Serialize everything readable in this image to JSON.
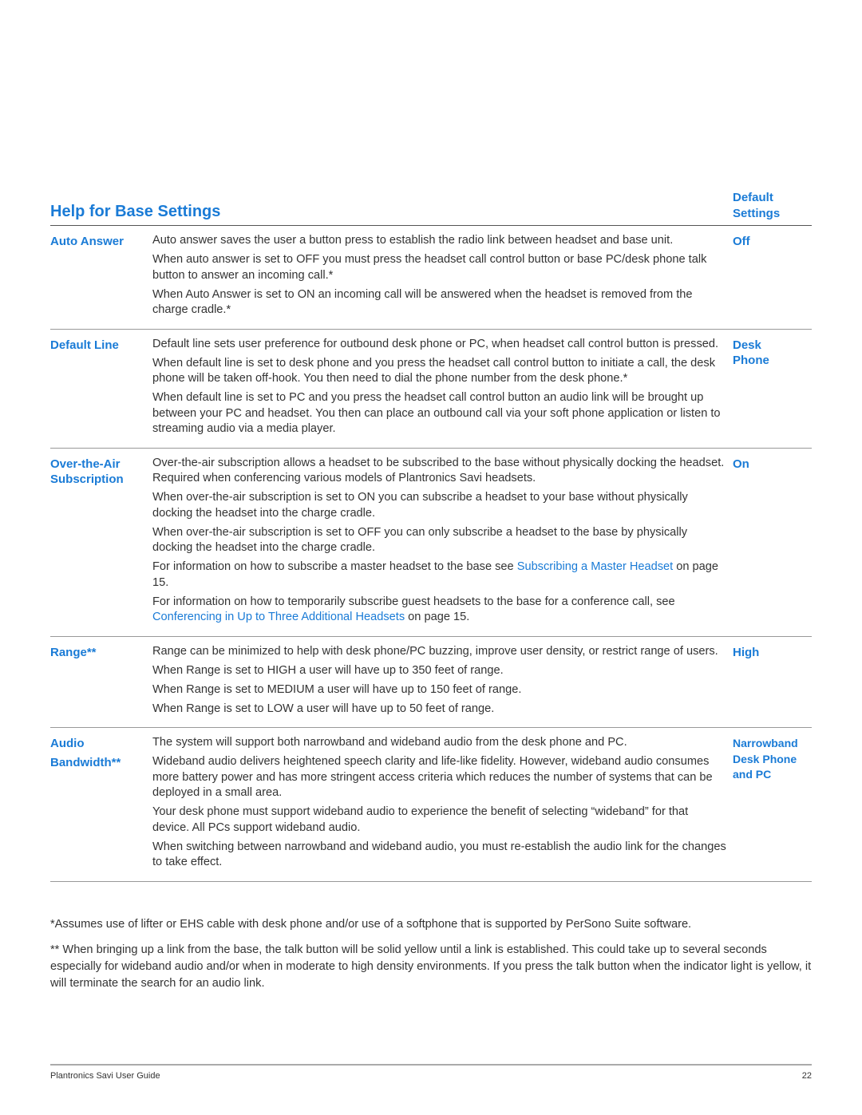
{
  "header": {
    "title": "Help for Base Settings",
    "default_column_line1": "Default",
    "default_column_line2": "Settings"
  },
  "rows": [
    {
      "label_line1": "Auto Answer",
      "label_line2": "",
      "default_lines": [
        "Off"
      ],
      "paragraphs": [
        "Auto answer saves the user a button press to establish the radio link between headset and base unit.",
        "When auto answer is set to OFF you must press the headset call control button or base PC/desk phone talk button to answer an incoming call.*",
        "When Auto Answer is set to ON an incoming call will be answered when the headset is removed from the charge cradle.*"
      ]
    },
    {
      "label_line1": "Default Line",
      "label_line2": "",
      "default_lines": [
        "Desk",
        "Phone"
      ],
      "paragraphs": [
        "Default line sets user preference for outbound desk phone or PC, when headset call control button is pressed.",
        "When default line is set to desk phone and you press the headset call control button to initiate a call, the desk phone will be taken off-hook. You then need to dial the phone number from the desk phone.*",
        "When default line is set to PC and you press the headset call control button an audio link will be brought up between your PC and headset. You then can place an outbound call via your soft phone application or listen to streaming audio via a media player."
      ]
    },
    {
      "label_line1": "Over-the-Air",
      "label_line2": "Subscription",
      "default_lines": [
        "On"
      ],
      "paragraphs": [
        "Over-the-air subscription allows a headset to be subscribed to the base without physically docking the headset. Required when conferencing various models of Plantronics Savi headsets.",
        "When over-the-air subscription is set to ON you can subscribe a headset to your base without physically docking the headset into the charge cradle.",
        "When over-the-air subscription is set to OFF you can only subscribe a headset to the base by physically docking the headset into the charge cradle."
      ],
      "link_paragraphs": [
        {
          "before": "For information on how to subscribe a master headset to the base see ",
          "link": "Subscribing a Master Headset",
          "after": " on page 15."
        },
        {
          "before": "For information on how to temporarily subscribe guest headsets to the base for a conference call, see ",
          "link": "Conferencing in Up to Three Additional Headsets",
          "after": " on page 15."
        }
      ]
    },
    {
      "label_line1": "Range**",
      "label_line2": "",
      "default_lines": [
        "High"
      ],
      "paragraphs": [
        "Range can be minimized to help with desk phone/PC buzzing, improve user density, or restrict range of users.",
        "When Range is set to HIGH a user will have up to 350 feet of range.",
        "When Range is set to MEDIUM a user will have up to 150 feet of range.",
        "When Range is set to LOW a user will have up to 50 feet of range."
      ]
    },
    {
      "label_line1": "Audio",
      "label_line2": "Bandwidth**",
      "default_lines": [
        "Narrowband",
        "Desk Phone",
        "and PC"
      ],
      "paragraphs": [
        "The system will support both narrowband and wideband audio from the desk phone and PC.",
        "Wideband audio delivers heightened speech clarity and life-like fidelity. However, wideband audio consumes more battery power and has more stringent access criteria which reduces the number of systems that can be deployed in a small area.",
        "Your desk phone must support wideband audio to experience the benefit of selecting “wideband” for that device. All PCs support wideband audio.",
        "When switching between narrowband and wideband audio, you must re-establish the audio link for the changes to take effect."
      ]
    }
  ],
  "notes": [
    "*Assumes use of lifter or EHS cable with desk phone and/or use of a softphone that is supported by PerSono Suite software.",
    "** When bringing up a link from the base, the talk button will be solid yellow until a link is established. This could take up to several seconds especially for wideband audio and/or when in moderate to high density environments. If you press the talk button when the indicator light is yellow, it will terminate the search for an audio link."
  ],
  "footer": {
    "guide_title": "Plantronics Savi User Guide",
    "page_number": "22"
  },
  "colors": {
    "accent": "#1a7bd6",
    "text": "#333333"
  }
}
